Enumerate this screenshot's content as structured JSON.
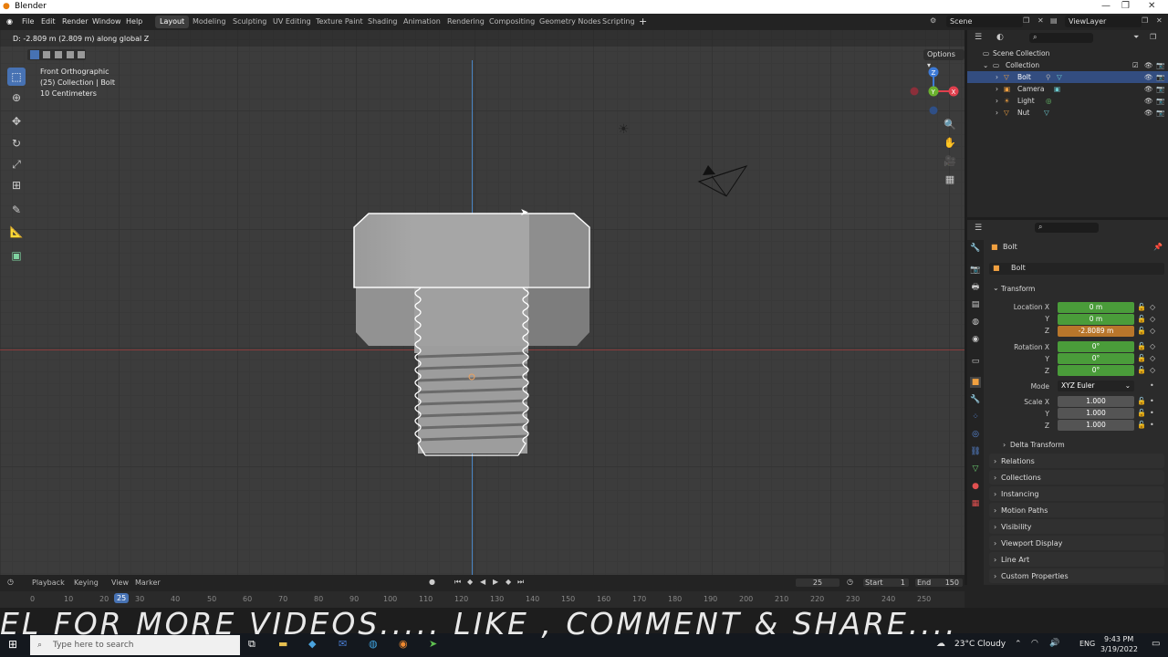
{
  "window": {
    "title": "Blender"
  },
  "menu": [
    "File",
    "Edit",
    "Render",
    "Window",
    "Help"
  ],
  "workspaces": [
    "Layout",
    "Modeling",
    "Sculpting",
    "UV Editing",
    "Texture Paint",
    "Shading",
    "Animation",
    "Rendering",
    "Compositing",
    "Geometry Nodes",
    "Scripting"
  ],
  "active_workspace": "Layout",
  "scene": "Scene",
  "view_layer": "ViewLayer",
  "viewport": {
    "status": "D: -2.809 m (2.809 m) along global Z",
    "view_name": "Front Orthographic",
    "collection_info": "(25) Collection | Bolt",
    "scale_info": "10 Centimeters",
    "options_label": "Options",
    "gizmo": {
      "z": "Z",
      "y": "Y",
      "x": "X"
    }
  },
  "outliner": {
    "root": "Scene Collection",
    "collection": "Collection",
    "items": [
      "Bolt",
      "Camera",
      "Light",
      "Nut"
    ],
    "selected": "Bolt"
  },
  "properties": {
    "object_name": "Bolt",
    "data_name": "Bolt",
    "transform_header": "Transform",
    "location_label": "Location X",
    "location": [
      "0 m",
      "0 m",
      "-2.8089 m"
    ],
    "rotation_label": "Rotation X",
    "rotation": [
      "0°",
      "0°",
      "0°"
    ],
    "mode_label": "Mode",
    "mode_value": "XYZ Euler",
    "scale_label": "Scale X",
    "scale": [
      "1.000",
      "1.000",
      "1.000"
    ],
    "axis_y": "Y",
    "axis_z": "Z",
    "panels": [
      "Delta Transform",
      "Relations",
      "Collections",
      "Instancing",
      "Motion Paths",
      "Visibility",
      "Viewport Display",
      "Line Art",
      "Custom Properties"
    ]
  },
  "timeline": {
    "menus": [
      "Playback",
      "Keying",
      "View",
      "Marker"
    ],
    "current_frame": "25",
    "start_label": "Start",
    "start": "1",
    "end_label": "End",
    "end": "150",
    "ticks": [
      "0",
      "10",
      "20",
      "25",
      "30",
      "40",
      "50",
      "60",
      "70",
      "80",
      "90",
      "100",
      "110",
      "120",
      "130",
      "140",
      "150",
      "160",
      "170",
      "180",
      "190",
      "200",
      "210",
      "220",
      "230",
      "240",
      "250"
    ]
  },
  "caption": "EL FOR MORE VIDEOS..... LIKE , COMMENT & SHARE....",
  "taskbar": {
    "search_placeholder": "Type here to search",
    "weather": "23°C  Cloudy",
    "language": "ENG",
    "time": "9:43 PM",
    "date": "3/19/2022"
  },
  "colors": {
    "accent": "#4772b3",
    "green_field": "#4a9c3a",
    "orange_field": "#b8762b"
  }
}
